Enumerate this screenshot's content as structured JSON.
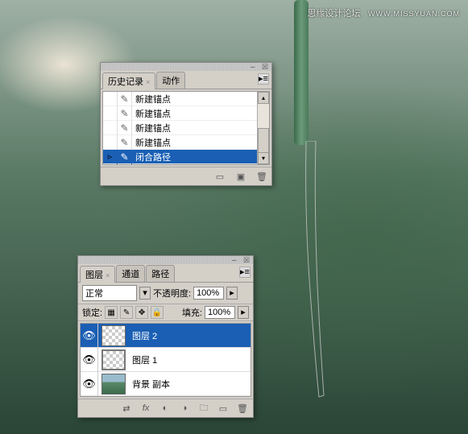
{
  "watermark": {
    "text": "思缘设计论坛",
    "url": "WWW.MISSYUAN.COM"
  },
  "history": {
    "tabs": [
      {
        "label": "历史记录",
        "active": true
      },
      {
        "label": "动作",
        "active": false
      }
    ],
    "items": [
      {
        "label": "新建锚点",
        "selected": false
      },
      {
        "label": "新建锚点",
        "selected": false
      },
      {
        "label": "新建锚点",
        "selected": false
      },
      {
        "label": "新建锚点",
        "selected": false
      },
      {
        "label": "闭合路径",
        "selected": true
      }
    ]
  },
  "layers": {
    "tabs": [
      {
        "label": "图层",
        "active": true
      },
      {
        "label": "通道",
        "active": false
      },
      {
        "label": "路径",
        "active": false
      }
    ],
    "blend_mode": "正常",
    "opacity_label": "不透明度:",
    "opacity_value": "100%",
    "lock_label": "锁定:",
    "fill_label": "填充:",
    "fill_value": "100%",
    "items": [
      {
        "label": "图层 2",
        "selected": true,
        "thumb": "checker"
      },
      {
        "label": "图层 1",
        "selected": false,
        "thumb": "checker"
      },
      {
        "label": "背景 副本",
        "selected": false,
        "thumb": "img"
      }
    ]
  }
}
